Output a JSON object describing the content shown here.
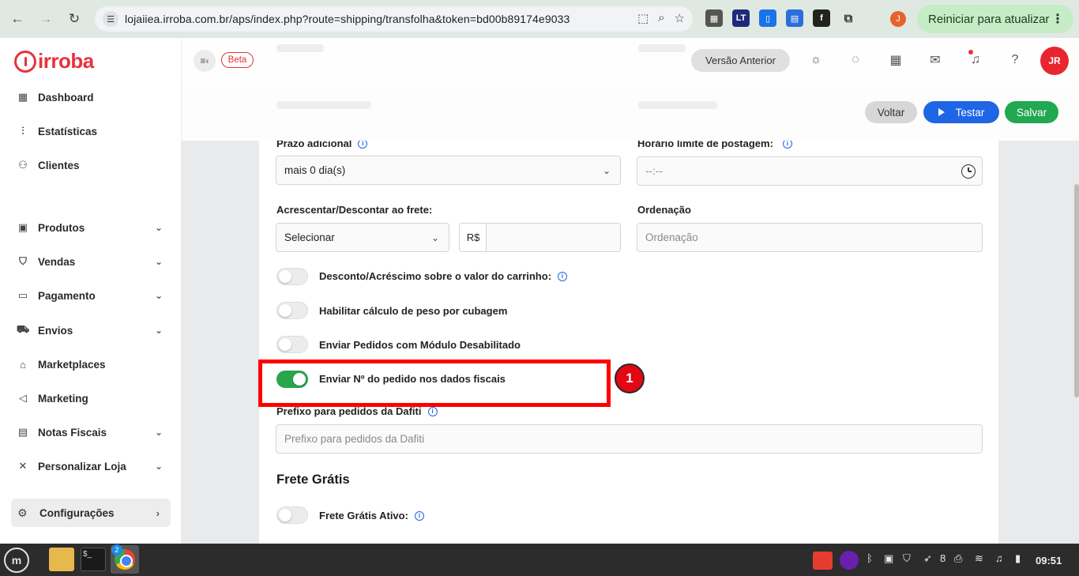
{
  "browser": {
    "url": "lojaiiea.irroba.com.br/aps/index.php?route=shipping/transfolha&token=bd00b89174e9033",
    "profile_initial": "J",
    "update_label": "Reiniciar para atualizar"
  },
  "sidebar": {
    "logo": "irroba",
    "items": [
      {
        "label": "Dashboard",
        "icon": "dashboard-icon",
        "has_chevron": false
      },
      {
        "label": "Estatísticas",
        "icon": "chart-icon",
        "has_chevron": false
      },
      {
        "label": "Clientes",
        "icon": "users-icon",
        "has_chevron": false
      },
      {
        "label": "Produtos",
        "icon": "box-icon",
        "has_chevron": true
      },
      {
        "label": "Vendas",
        "icon": "bag-icon",
        "has_chevron": true
      },
      {
        "label": "Pagamento",
        "icon": "card-icon",
        "has_chevron": true
      },
      {
        "label": "Envios",
        "icon": "truck-icon",
        "has_chevron": true
      },
      {
        "label": "Marketplaces",
        "icon": "store-icon",
        "has_chevron": false
      },
      {
        "label": "Marketing",
        "icon": "megaphone-icon",
        "has_chevron": false
      },
      {
        "label": "Notas Fiscais",
        "icon": "document-icon",
        "has_chevron": true
      },
      {
        "label": "Personalizar Loja",
        "icon": "tools-icon",
        "has_chevron": true
      }
    ],
    "config_label": "Configurações"
  },
  "header": {
    "beta": "Beta",
    "versao_anterior": "Versão Anterior",
    "avatar_initials": "JR"
  },
  "actions": {
    "voltar": "Voltar",
    "testar": "Testar",
    "salvar": "Salvar"
  },
  "form": {
    "prazo_label": "Prazo adicional",
    "prazo_value": "mais 0 dia(s)",
    "horario_label": "Horário limite de postagem:",
    "horario_placeholder": "--:--",
    "acrescentar_label": "Acrescentar/Descontar ao frete:",
    "acrescentar_value": "Selecionar",
    "currency_prefix": "R$",
    "ordenacao_label": "Ordenação",
    "ordenacao_placeholder": "Ordenação",
    "toggles": [
      {
        "label": "Desconto/Acréscimo sobre o valor do carrinho:",
        "on": false,
        "info": true
      },
      {
        "label": "Habilitar cálculo de peso por cubagem",
        "on": false,
        "info": false
      },
      {
        "label": "Enviar Pedidos com Módulo Desabilitado",
        "on": false,
        "info": false
      },
      {
        "label": "Enviar Nº do pedido nos dados fiscais",
        "on": true,
        "info": false
      }
    ],
    "prefixo_label": "Prefixo para pedidos da Dafiti",
    "prefixo_placeholder": "Prefixo para pedidos da Dafiti",
    "frete_gratis_title": "Frete Grátis",
    "frete_gratis_toggle": "Frete Grátis Ativo:"
  },
  "annotation": {
    "marker": "1"
  },
  "taskbar": {
    "chrome_badge": "2",
    "tray_count": "8",
    "time": "09:51"
  }
}
